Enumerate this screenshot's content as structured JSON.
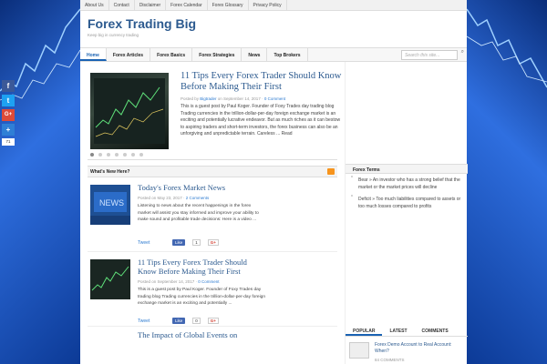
{
  "top_links": [
    "About Us",
    "Contact",
    "Disclaimer",
    "Forex Calendar",
    "Forex Glossary",
    "Privacy Policy"
  ],
  "site": {
    "title": "Forex Trading Big",
    "tagline": "Keep big in currency trading"
  },
  "main_nav": [
    "Home",
    "Forex Articles",
    "Forex Basics",
    "Forex Strategies",
    "News",
    "Top Brokers"
  ],
  "search": {
    "placeholder": "Search this site..."
  },
  "social": {
    "share_count": "71"
  },
  "featured": {
    "title": "11 Tips Every Forex Trader Should Know Before Making Their First",
    "meta_prefix": "Posted by ",
    "author": "Bigtrader",
    "meta_mid": " on September 14, 2017 · ",
    "comments": "0 Comment",
    "excerpt": "This is a guest post by Paul Koger. Founder of Foxy Trades day trading blog Trading currencies in the trillion-dollar-per-day foreign exchange market is an exciting and potentially lucrative endeavor. But as much riches as it can bestow to aspiring traders and short-term investors, the forex business can also be an unforgiving and unpredictable terrain. Careless ... Read"
  },
  "whats_new": {
    "heading": "What's New Here?",
    "posts": [
      {
        "title": "Today's Forex Market News",
        "meta": "Posted on May 23, 2017 · ",
        "comments": "2 Comments",
        "excerpt": "Listening to news about the recent happenings in the forex market will assist you stay informed and improve your ability to make sound and profitable trade decisions: Here is a video ...",
        "tweet": "Tweet",
        "like": "Like",
        "likes": "1",
        "gplus": "G+"
      },
      {
        "title": "11 Tips Every Forex Trader Should Know Before Making Their First",
        "meta": "Posted on September 14, 2017 · ",
        "comments": "0 Comment",
        "excerpt": "This is a guest post by Paul Koger. Founder of Foxy Trades day trading blog Trading currencies in the trillion-dollar-per-day foreign exchange market is an exciting and potentially ...",
        "tweet": "Tweet",
        "like": "Like",
        "likes": "0",
        "gplus": "G+"
      }
    ],
    "next_title": "The Impact of Global Events on"
  },
  "forex_terms": {
    "heading": "Forex Terms",
    "items": [
      "Bear » An investor who has a strong belief that the market or the market prices will decline",
      "Deficit » Too much liabilities compared to assets or too much losses compared to profits"
    ]
  },
  "sidebar_tabs": [
    "POPULAR",
    "LATEST",
    "COMMENTS"
  ],
  "popular": {
    "title": "Forex Demo Account to Real Account: When?",
    "comments": "84 COMMENTS"
  }
}
